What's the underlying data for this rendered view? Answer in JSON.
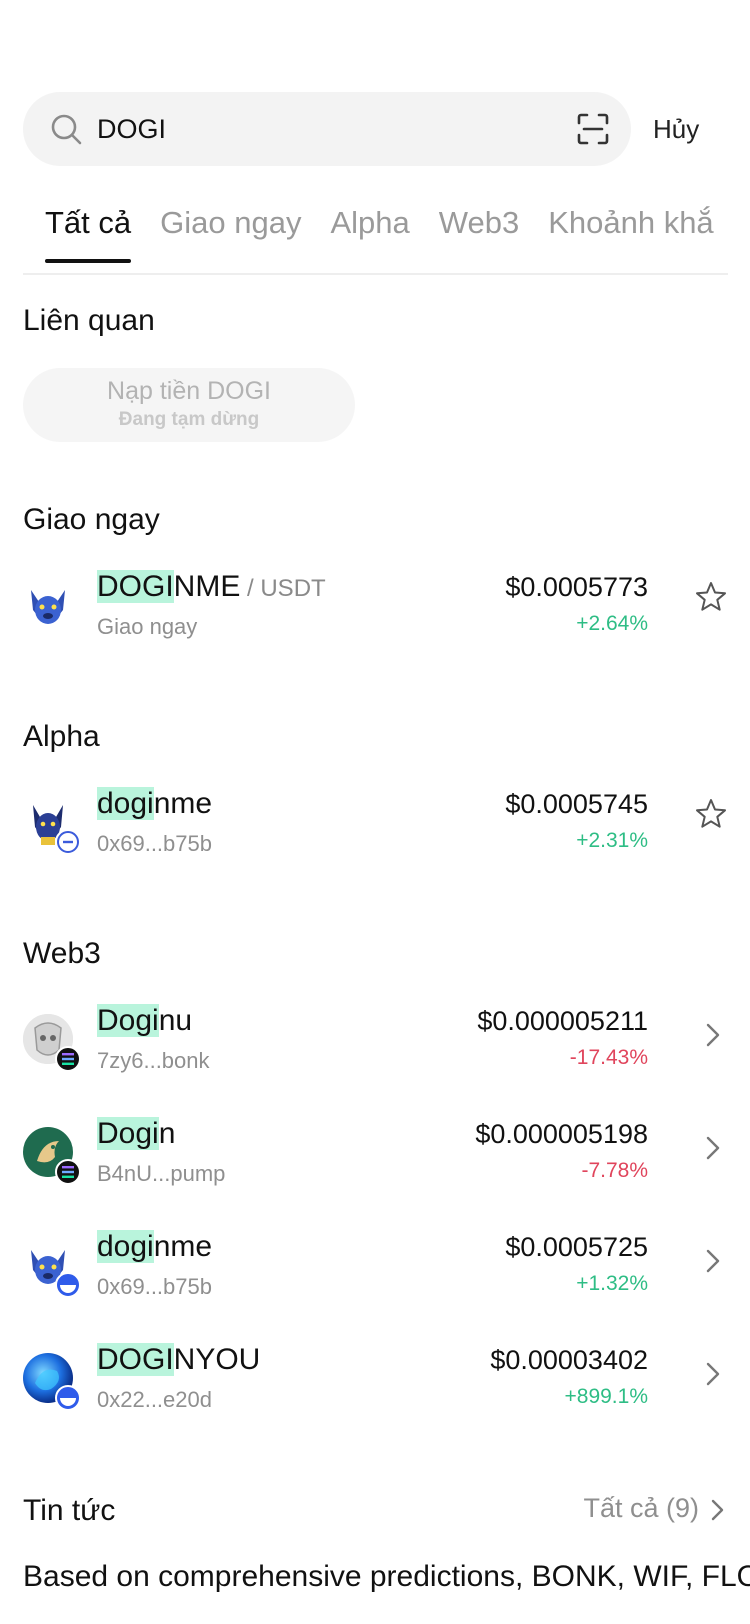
{
  "search": {
    "query": "DOGI",
    "cancel_label": "Hủy"
  },
  "tabs": [
    {
      "label": "Tất cả",
      "active": true
    },
    {
      "label": "Giao ngay",
      "active": false
    },
    {
      "label": "Alpha",
      "active": false
    },
    {
      "label": "Web3",
      "active": false
    },
    {
      "label": "Khoảnh khắ",
      "active": false
    }
  ],
  "related": {
    "title": "Liên quan",
    "deposit_label": "Nạp tiền DOGI",
    "deposit_status": "Đang tạm dừng"
  },
  "spot": {
    "title": "Giao ngay",
    "items": [
      {
        "name_hl": "DOGI",
        "name_rest": "NME",
        "pair": " / USDT",
        "sub": "Giao ngay",
        "price": "$0.0005773",
        "change": "+2.64%",
        "trend": "up",
        "icon": "dog-token-icon"
      }
    ]
  },
  "alpha": {
    "title": "Alpha",
    "items": [
      {
        "name_hl": "dogi",
        "name_rest": "nme",
        "sub": "0x69...b75b",
        "price": "$0.0005745",
        "change": "+2.31%",
        "trend": "up",
        "icon": "dog-token-icon"
      }
    ]
  },
  "web3": {
    "title": "Web3",
    "items": [
      {
        "name_hl": "Dogi",
        "name_rest": "nu",
        "sub": "7zy6...bonk",
        "price": "$0.000005211",
        "change": "-17.43%",
        "trend": "down",
        "icon": "doginu-token-icon",
        "badge": "solana-chain-icon"
      },
      {
        "name_hl": "Dogi",
        "name_rest": "n",
        "sub": "B4nU...pump",
        "price": "$0.000005198",
        "change": "-7.78%",
        "trend": "down",
        "icon": "dogin-token-icon",
        "badge": "solana-chain-icon"
      },
      {
        "name_hl": "dogi",
        "name_rest": "nme",
        "sub": "0x69...b75b",
        "price": "$0.0005725",
        "change": "+1.32%",
        "trend": "up",
        "icon": "dog-token-icon",
        "badge": "base-chain-icon"
      },
      {
        "name_hl": "DOGI",
        "name_rest": "NYOU",
        "sub": "0x22...e20d",
        "price": "$0.00003402",
        "change": "+899.1%",
        "trend": "up",
        "icon": "doginyou-token-icon",
        "badge": "base-chain-icon"
      }
    ]
  },
  "news": {
    "title": "Tin tức",
    "all_label": "Tất cả (9)",
    "peek_text": "Based on comprehensive predictions, BONK, WIF, FLO"
  },
  "colors": {
    "up": "#2ebd85",
    "down": "#e0455c",
    "highlight": "#b9f4dc"
  }
}
